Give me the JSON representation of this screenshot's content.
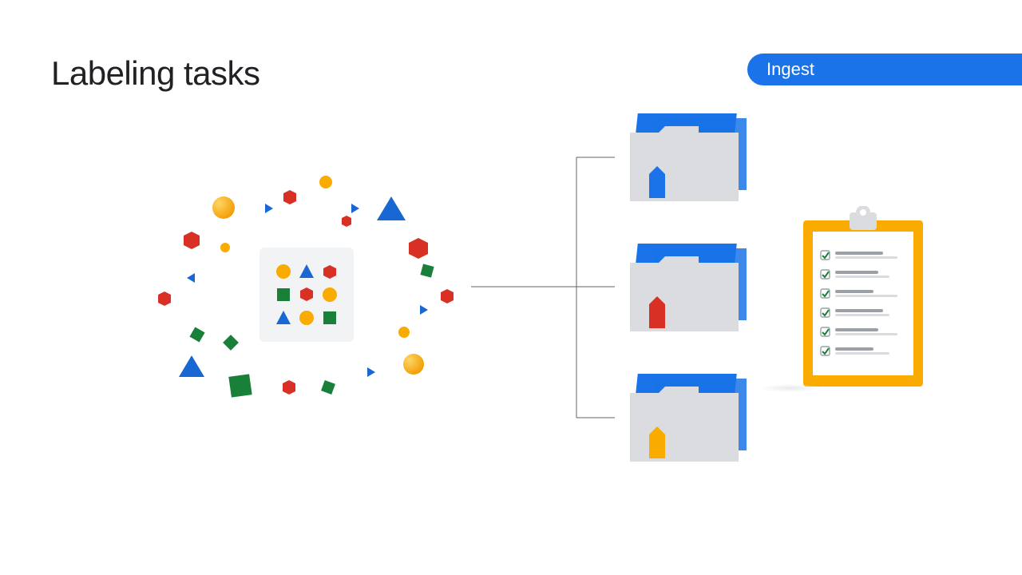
{
  "title": "Labeling tasks",
  "badge": "Ingest",
  "colors": {
    "blue": "#1a73e8",
    "blueTri": "#1967d2",
    "red": "#d93025",
    "green": "#188038",
    "yellow": "#fbbc04",
    "orange": "#f9ab00",
    "grey": "#dadce0",
    "greyDk": "#bdc1c6",
    "line": "#5f6368"
  },
  "folders": [
    {
      "markerColor": "#1a73e8"
    },
    {
      "markerColor": "#d93025"
    },
    {
      "markerColor": "#f9ab00"
    }
  ],
  "checklistItems": 6
}
